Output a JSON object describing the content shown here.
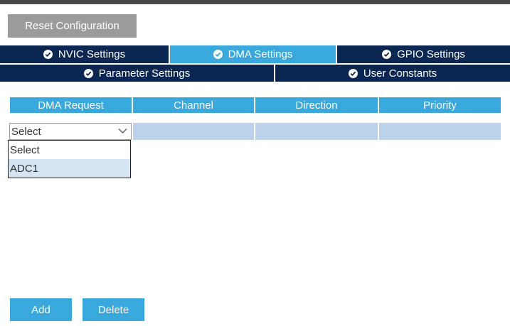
{
  "toolbar": {
    "reset_label": "Reset Configuration"
  },
  "tabs_row1": [
    {
      "label": "NVIC Settings",
      "active": false
    },
    {
      "label": "DMA Settings",
      "active": true
    },
    {
      "label": "GPIO Settings",
      "active": false
    }
  ],
  "tabs_row2": [
    {
      "label": "Parameter Settings",
      "active": false
    },
    {
      "label": "User Constants",
      "active": false
    }
  ],
  "table": {
    "headers": [
      "DMA Request",
      "Channel",
      "Direction",
      "Priority"
    ]
  },
  "select": {
    "value": "Select",
    "options": [
      "Select",
      "ADC1"
    ]
  },
  "actions": {
    "add_label": "Add",
    "delete_label": "Delete"
  },
  "colors": {
    "tab_dark": "#0b2650",
    "accent_blue": "#39a8dc",
    "row_fill": "#bcd2ea",
    "reset_gray": "#9b9b9b"
  }
}
